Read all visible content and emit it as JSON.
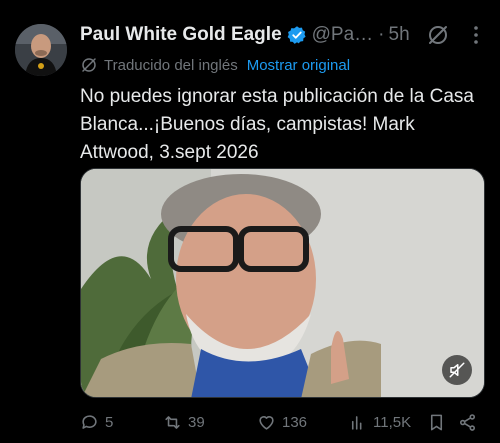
{
  "author": {
    "display_name": "Paul White Gold Eagle",
    "handle": "@Pa…",
    "separator": "·",
    "time": "5h",
    "verified": true
  },
  "translation": {
    "label": "Traducido del inglés",
    "show_original": "Mostrar original"
  },
  "text": "No puedes ignorar esta publicación de la Casa Blanca...¡Buenos días, campistas! Mark Attwood, 3.sept 2026",
  "actions": {
    "replies": "5",
    "retweets": "39",
    "likes": "136",
    "views": "11,5K"
  },
  "icons": [
    "grok-icon",
    "more-icon",
    "translate-icon",
    "mute-icon",
    "reply-icon",
    "retweet-icon",
    "like-icon",
    "views-icon",
    "bookmark-icon",
    "share-icon"
  ],
  "colors": {
    "background": "#000000",
    "primary_text": "#e7e9ea",
    "secondary_text": "#71767b",
    "accent": "#1d9bf0"
  }
}
